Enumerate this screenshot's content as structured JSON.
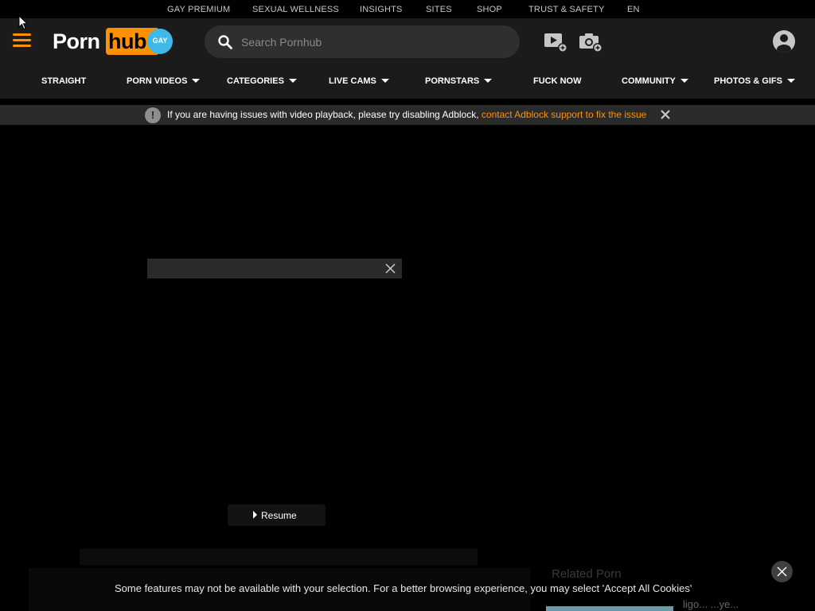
{
  "top_links": [
    "GAY PREMIUM",
    "SEXUAL WELLNESS",
    "INSIGHTS",
    "SITES",
    "SHOP",
    "TRUST & SAFETY",
    "EN"
  ],
  "logo": {
    "part1": "Porn",
    "part2": "hub",
    "badge": "GAY"
  },
  "search": {
    "placeholder": "Search Pornhub",
    "value": ""
  },
  "header_icons": [
    "upload-video-icon",
    "upload-photo-icon",
    "user-account-icon"
  ],
  "nav": [
    {
      "label": "STRAIGHT",
      "dropdown": false
    },
    {
      "label": "PORN VIDEOS",
      "dropdown": true
    },
    {
      "label": "CATEGORIES",
      "dropdown": true
    },
    {
      "label": "LIVE CAMS",
      "dropdown": true
    },
    {
      "label": "PORNSTARS",
      "dropdown": true
    },
    {
      "label": "FUCK NOW",
      "dropdown": false
    },
    {
      "label": "COMMUNITY",
      "dropdown": true
    },
    {
      "label": "PHOTOS & GIFS",
      "dropdown": true
    }
  ],
  "notice": {
    "icon": "!",
    "message": "If you are having issues with video playback, please try disabling Adblock, ",
    "link": "contact Adblock support to fix the issue"
  },
  "player": {
    "resume_label": "Resume"
  },
  "sidebar": {
    "heading": "Related Porn",
    "faded_text": "ligo... ...ye..."
  },
  "cookie_banner": {
    "text": "Some features may not be available with your selection. For a better browsing experience, you may select  'Accept All Cookies'"
  },
  "colors": {
    "accent": "#ff9000",
    "header_bg": "#1b1b1b",
    "badge": "#41b8e8",
    "page_bg": "#000000"
  }
}
